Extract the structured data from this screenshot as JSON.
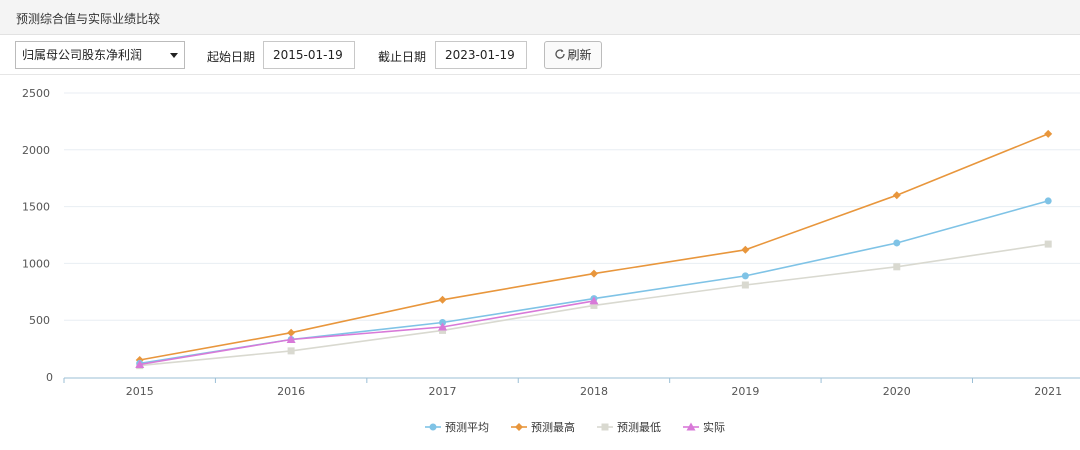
{
  "panel": {
    "title": "预测综合值与实际业绩比较"
  },
  "toolbar": {
    "metric_select": "归属母公司股东净利润",
    "start_label": "起始日期",
    "start_value": "2015-01-19",
    "end_label": "截止日期",
    "end_value": "2023-01-19",
    "refresh_label": "刷新",
    "refresh_icon": "refresh-icon"
  },
  "chart_data": {
    "type": "line",
    "categories": [
      "2015",
      "2016",
      "2017",
      "2018",
      "2019",
      "2020",
      "2021"
    ],
    "yticks": [
      "0",
      "500",
      "1000",
      "1500",
      "2000",
      "2500"
    ],
    "ylim": [
      0,
      2500
    ],
    "grid": true,
    "legend_position": "bottom-center",
    "series": [
      {
        "name": "预测平均",
        "color": "#7fc3e6",
        "marker": "circle",
        "values": [
          120,
          330,
          480,
          690,
          890,
          1180,
          1550
        ]
      },
      {
        "name": "预测最高",
        "color": "#e8963c",
        "marker": "diamond",
        "values": [
          150,
          390,
          680,
          910,
          1120,
          1600,
          2140
        ]
      },
      {
        "name": "预测最低",
        "color": "#d9d9d0",
        "marker": "square",
        "values": [
          100,
          230,
          410,
          630,
          810,
          970,
          1170
        ]
      },
      {
        "name": "实际",
        "color": "#d879d8",
        "marker": "triangle",
        "values": [
          110,
          330,
          440,
          670,
          null,
          null,
          null
        ]
      }
    ]
  }
}
